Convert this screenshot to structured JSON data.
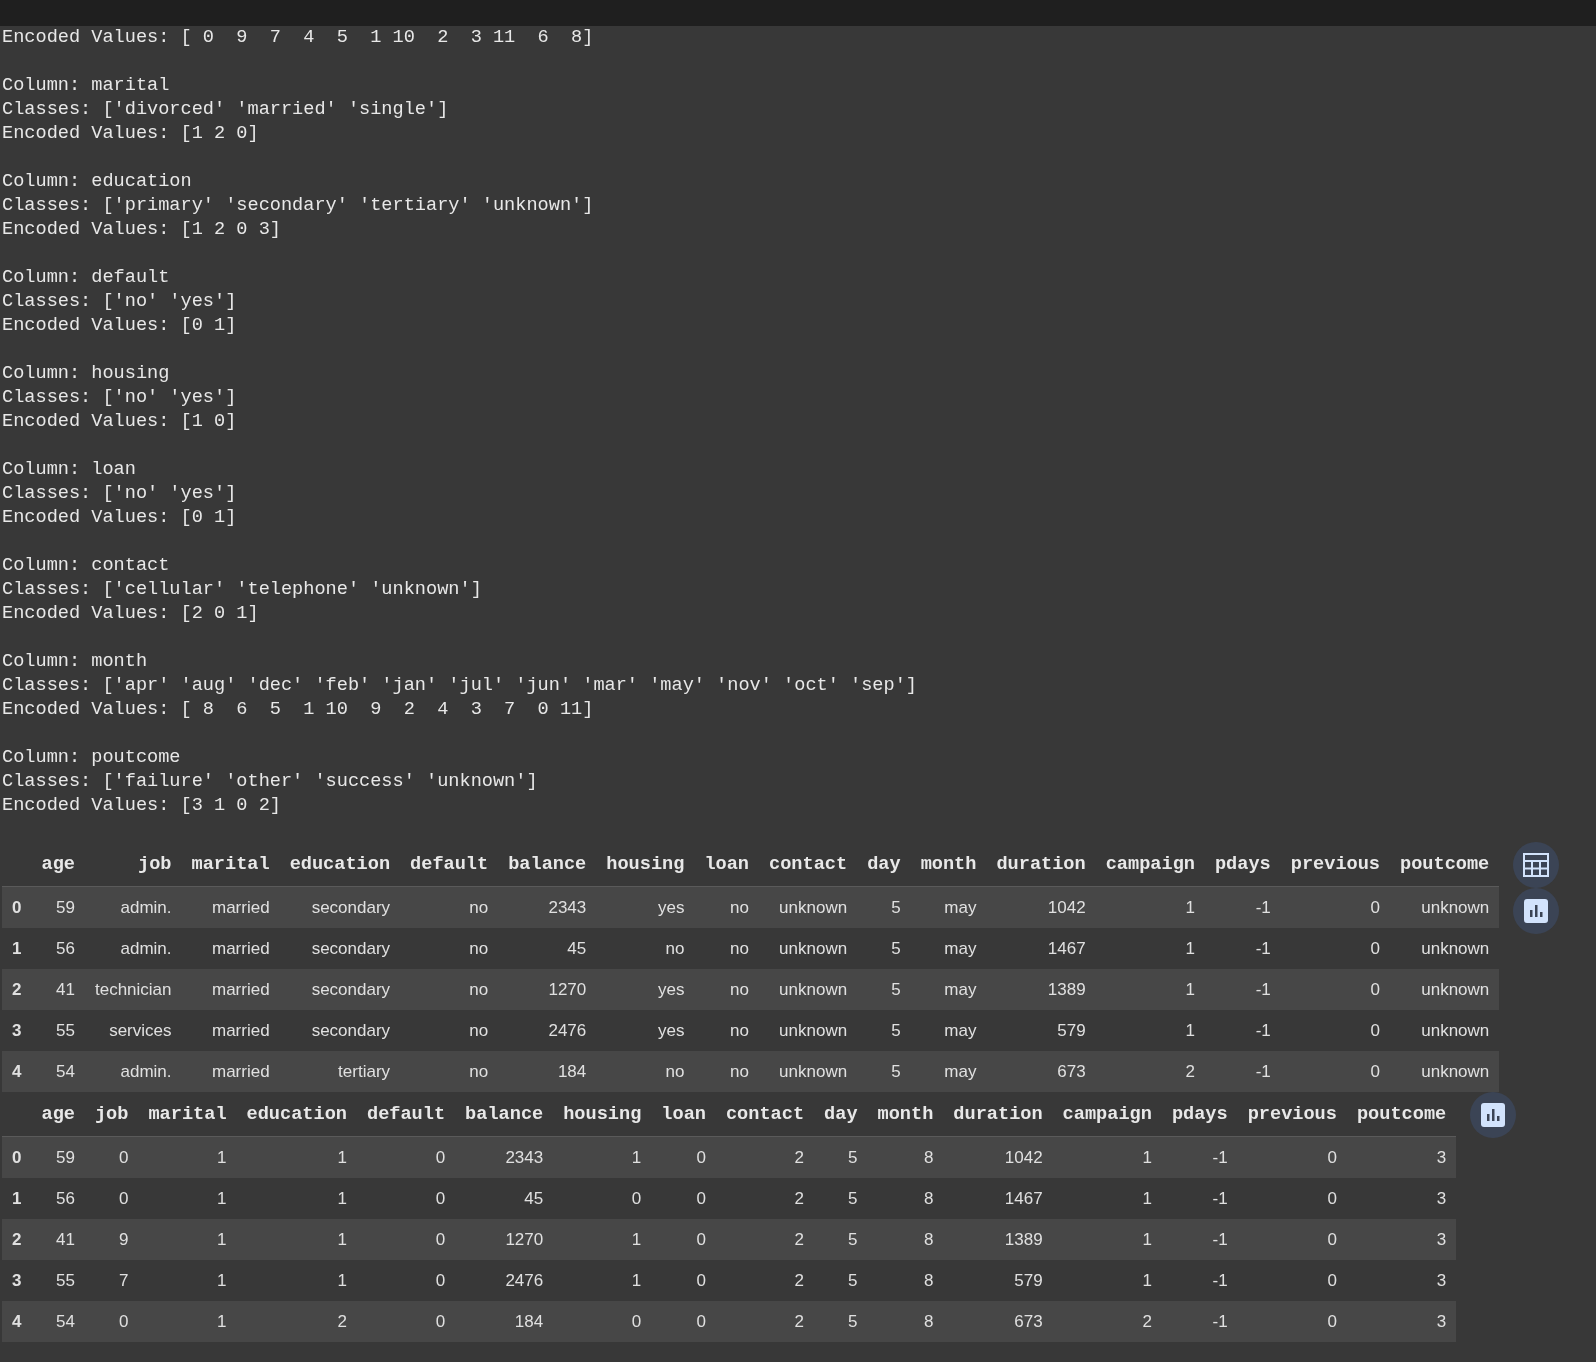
{
  "output": [
    {
      "lines": [
        "Encoded Values: [ 0  9  7  4  5  1 10  2  3 11  6  8]"
      ]
    },
    {
      "lines": [
        "Column: marital",
        "Classes: ['divorced' 'married' 'single']",
        "Encoded Values: [1 2 0]"
      ]
    },
    {
      "lines": [
        "Column: education",
        "Classes: ['primary' 'secondary' 'tertiary' 'unknown']",
        "Encoded Values: [1 2 0 3]"
      ]
    },
    {
      "lines": [
        "Column: default",
        "Classes: ['no' 'yes']",
        "Encoded Values: [0 1]"
      ]
    },
    {
      "lines": [
        "Column: housing",
        "Classes: ['no' 'yes']",
        "Encoded Values: [1 0]"
      ]
    },
    {
      "lines": [
        "Column: loan",
        "Classes: ['no' 'yes']",
        "Encoded Values: [0 1]"
      ]
    },
    {
      "lines": [
        "Column: contact",
        "Classes: ['cellular' 'telephone' 'unknown']",
        "Encoded Values: [2 0 1]"
      ]
    },
    {
      "lines": [
        "Column: month",
        "Classes: ['apr' 'aug' 'dec' 'feb' 'jan' 'jul' 'jun' 'mar' 'may' 'nov' 'oct' 'sep']",
        "Encoded Values: [ 8  6  5  1 10  9  2  4  3  7  0 11]"
      ]
    },
    {
      "lines": [
        "Column: poutcome",
        "Classes: ['failure' 'other' 'success' 'unknown']",
        "Encoded Values: [3 1 0 2]"
      ]
    }
  ],
  "tables": [
    {
      "columns": [
        "age",
        "job",
        "marital",
        "education",
        "default",
        "balance",
        "housing",
        "loan",
        "contact",
        "day",
        "month",
        "duration",
        "campaign",
        "pdays",
        "previous",
        "poutcome"
      ],
      "rows": [
        {
          "index": "0",
          "cells": [
            "59",
            "admin.",
            "married",
            "secondary",
            "no",
            "2343",
            "yes",
            "no",
            "unknown",
            "5",
            "may",
            "1042",
            "1",
            "-1",
            "0",
            "unknown"
          ]
        },
        {
          "index": "1",
          "cells": [
            "56",
            "admin.",
            "married",
            "secondary",
            "no",
            "45",
            "no",
            "no",
            "unknown",
            "5",
            "may",
            "1467",
            "1",
            "-1",
            "0",
            "unknown"
          ]
        },
        {
          "index": "2",
          "cells": [
            "41",
            "technician",
            "married",
            "secondary",
            "no",
            "1270",
            "yes",
            "no",
            "unknown",
            "5",
            "may",
            "1389",
            "1",
            "-1",
            "0",
            "unknown"
          ]
        },
        {
          "index": "3",
          "cells": [
            "55",
            "services",
            "married",
            "secondary",
            "no",
            "2476",
            "yes",
            "no",
            "unknown",
            "5",
            "may",
            "579",
            "1",
            "-1",
            "0",
            "unknown"
          ]
        },
        {
          "index": "4",
          "cells": [
            "54",
            "admin.",
            "married",
            "tertiary",
            "no",
            "184",
            "no",
            "no",
            "unknown",
            "5",
            "may",
            "673",
            "2",
            "-1",
            "0",
            "unknown"
          ]
        }
      ],
      "buttons": [
        {
          "kind": "table"
        },
        {
          "kind": "chart"
        }
      ]
    },
    {
      "columns": [
        "age",
        "job",
        "marital",
        "education",
        "default",
        "balance",
        "housing",
        "loan",
        "contact",
        "day",
        "month",
        "duration",
        "campaign",
        "pdays",
        "previous",
        "poutcome"
      ],
      "rows": [
        {
          "index": "0",
          "cells": [
            "59",
            "0",
            "1",
            "1",
            "0",
            "2343",
            "1",
            "0",
            "2",
            "5",
            "8",
            "1042",
            "1",
            "-1",
            "0",
            "3"
          ]
        },
        {
          "index": "1",
          "cells": [
            "56",
            "0",
            "1",
            "1",
            "0",
            "45",
            "0",
            "0",
            "2",
            "5",
            "8",
            "1467",
            "1",
            "-1",
            "0",
            "3"
          ]
        },
        {
          "index": "2",
          "cells": [
            "41",
            "9",
            "1",
            "1",
            "0",
            "1270",
            "1",
            "0",
            "2",
            "5",
            "8",
            "1389",
            "1",
            "-1",
            "0",
            "3"
          ]
        },
        {
          "index": "3",
          "cells": [
            "55",
            "7",
            "1",
            "1",
            "0",
            "2476",
            "1",
            "0",
            "2",
            "5",
            "8",
            "579",
            "1",
            "-1",
            "0",
            "3"
          ]
        },
        {
          "index": "4",
          "cells": [
            "54",
            "0",
            "1",
            "2",
            "0",
            "184",
            "0",
            "0",
            "2",
            "5",
            "8",
            "673",
            "2",
            "-1",
            "0",
            "3"
          ]
        }
      ],
      "buttons": [
        {
          "kind": "chart"
        }
      ]
    }
  ]
}
